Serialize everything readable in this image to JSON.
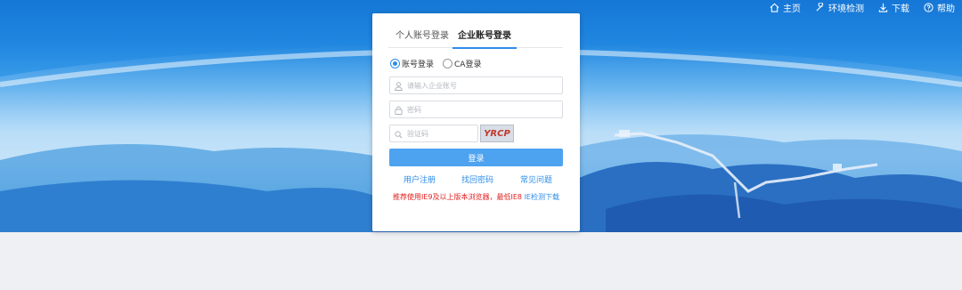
{
  "nav": {
    "items": [
      {
        "label": "主页",
        "icon": "home-icon"
      },
      {
        "label": "环境检测",
        "icon": "wrench-icon"
      },
      {
        "label": "下载",
        "icon": "download-icon"
      },
      {
        "label": "帮助",
        "icon": "help-icon"
      }
    ]
  },
  "login": {
    "tabs": [
      {
        "label": "个人账号登录"
      },
      {
        "label": "企业账号登录"
      }
    ],
    "radios": [
      {
        "label": "账号登录",
        "selected": true
      },
      {
        "label": "CA登录",
        "selected": false
      }
    ],
    "account_placeholder": "请输入企业账号",
    "password_placeholder": "密码",
    "captcha_placeholder": "验证码",
    "captcha_text": "YRCP",
    "submit_label": "登录",
    "links": [
      "用户注册",
      "找回密码",
      "常见问题"
    ],
    "notice_text": "推荐使用IE9及以上版本浏览器，最低IE8",
    "notice_link": "IE检测下载"
  },
  "colors": {
    "accent": "#2e8de8",
    "button": "#4ea3f0",
    "warning": "#e02020"
  }
}
